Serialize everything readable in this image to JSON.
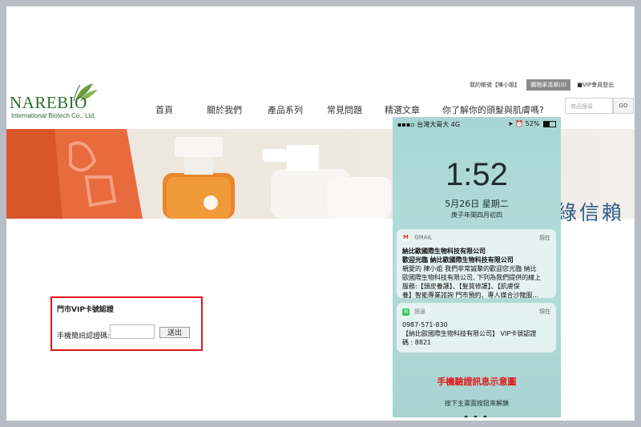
{
  "brand": {
    "name": "NAREBIO",
    "sub": "International Biotech Co., Ltd."
  },
  "topbar": {
    "account": "我的帳號【陳小姐】",
    "cart": "購物車清單(0)",
    "vip": "■VIP會員登出"
  },
  "nav": {
    "items": [
      "首頁",
      "關於我們",
      "產品系列",
      "常見問題",
      "精選文章",
      "你了解你的頭髮與肌膚嗎?"
    ]
  },
  "search": {
    "placeholder": "商品搜尋",
    "button": "GO"
  },
  "banner": {
    "slogan": "綠信賴"
  },
  "vip_form": {
    "title": "門市VIP卡號認證",
    "label": "手機簡訊認證碼:",
    "input_value": "",
    "submit": "送出"
  },
  "phone": {
    "carrier": "台灣大哥大",
    "network": "4G",
    "battery": "52%",
    "battery_level": 0.52,
    "time": "1:52",
    "date": "5月26日 星期二",
    "lunar": "庚子年閏四月初四",
    "notifications": [
      {
        "app": "GMAIL",
        "time": "現在",
        "lines": [
          "納比歐國際生物科技有限公司",
          "歡迎光臨 納比歐國際生物科技有限公司",
          "親愛的 陳小姐 我們非常誠摯的歡迎您光臨 納比",
          "歐國際生物科技有限公司, 下列為我們提供的線上",
          "服務:【頭皮養護】、【髮質修護】、【肌膚保",
          "養】智能專業諮詢 門市預約、專人媒合沙龍服..."
        ]
      },
      {
        "app": "訊息",
        "time": "現在",
        "lines": [
          "0987-571-830",
          "【納比歐國際生物科技有限公司】 VIP卡號認證",
          "碼 : 8821"
        ]
      }
    ],
    "demo_label": "手機驗證訊息示意圖",
    "unlock_hint": "按下主畫面按鈕來解鎖"
  },
  "colors": {
    "brand_green": "#2c6a2f",
    "highlight_red": "#e0161e",
    "slogan_blue": "#2f5f8c",
    "gmail_red": "#d93025",
    "messages_green": "#34c759"
  }
}
